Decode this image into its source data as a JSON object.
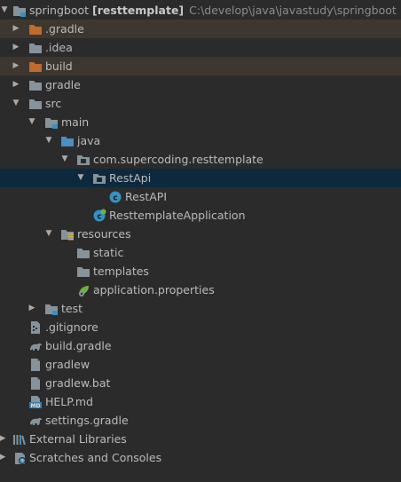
{
  "project": {
    "root_name": "springboot",
    "root_module": "[resttemplate]",
    "root_path": "C:\\develop\\java\\javastudy\\springboot"
  },
  "items": [
    {
      "label": ".gradle",
      "icon": "folder-icon",
      "expanded": false
    },
    {
      "label": ".idea",
      "icon": "folder-icon",
      "expanded": false
    },
    {
      "label": "build",
      "icon": "folder-icon",
      "expanded": false
    },
    {
      "label": "gradle",
      "icon": "folder-icon",
      "expanded": false
    },
    {
      "label": "src",
      "icon": "folder-icon",
      "expanded": true
    },
    {
      "label": "main",
      "icon": "folder-icon",
      "expanded": true
    },
    {
      "label": "java",
      "icon": "source-folder-icon",
      "expanded": true
    },
    {
      "label": "com.supercoding.resttemplate",
      "icon": "package-icon",
      "expanded": true
    },
    {
      "label": "RestApi",
      "icon": "package-icon",
      "expanded": true
    },
    {
      "label": "RestAPI",
      "icon": "class-icon"
    },
    {
      "label": "ResttemplateApplication",
      "icon": "spring-app-icon"
    },
    {
      "label": "resources",
      "icon": "resources-folder-icon",
      "expanded": true
    },
    {
      "label": "static",
      "icon": "folder-icon"
    },
    {
      "label": "templates",
      "icon": "folder-icon"
    },
    {
      "label": "application.properties",
      "icon": "properties-icon"
    },
    {
      "label": "test",
      "icon": "folder-icon",
      "expanded": false
    },
    {
      "label": ".gitignore",
      "icon": "gitignore-icon"
    },
    {
      "label": "build.gradle",
      "icon": "gradle-icon"
    },
    {
      "label": "gradlew",
      "icon": "file-icon"
    },
    {
      "label": "gradlew.bat",
      "icon": "file-icon"
    },
    {
      "label": "HELP.md",
      "icon": "markdown-icon"
    },
    {
      "label": "settings.gradle",
      "icon": "gradle-icon"
    },
    {
      "label": "External Libraries",
      "icon": "libraries-icon",
      "expanded": false
    },
    {
      "label": "Scratches and Consoles",
      "icon": "scratches-icon",
      "expanded": false
    }
  ],
  "colors": {
    "background": "#2b2b2b",
    "excluded_row": "#3d372f",
    "selected_row": "#0d293e",
    "folder": "#87939a",
    "excluded_folder": "#c06a2c",
    "source_folder": "#4a8fbf",
    "class_badge": "#3592c4",
    "spring": "#6db33f"
  }
}
